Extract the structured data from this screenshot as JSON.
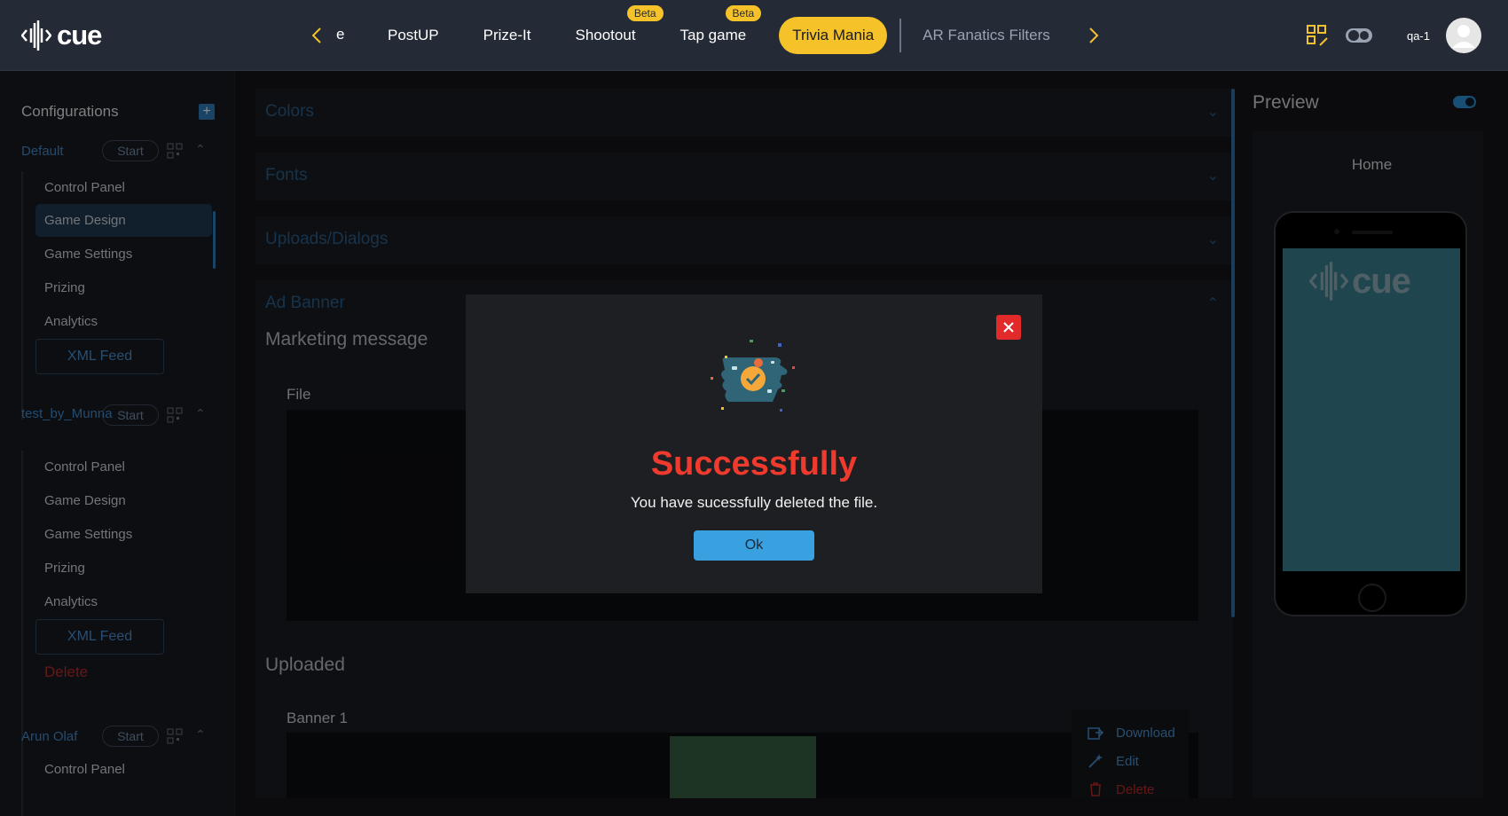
{
  "app": {
    "brand": "cue"
  },
  "nav": {
    "prev_partial": "e",
    "tabs": [
      {
        "label": "PostUP",
        "beta": ""
      },
      {
        "label": "Prize-It",
        "beta": ""
      },
      {
        "label": "Shootout",
        "beta": "Beta"
      },
      {
        "label": "Tap game",
        "beta": "Beta"
      }
    ],
    "active_tab": "Trivia Mania",
    "muted_tab": "AR Fanatics Filters"
  },
  "user": {
    "name": "qa-1"
  },
  "sidebar": {
    "title": "Configurations",
    "configs": [
      {
        "name": "Default",
        "start": "Start",
        "items": [
          "Control Panel",
          "Game Design",
          "Game Settings",
          "Prizing",
          "Analytics"
        ],
        "selected": "Game Design",
        "xml": "XML Feed"
      },
      {
        "name": "test_by_Munna",
        "start": "Start",
        "items": [
          "Control Panel",
          "Game Design",
          "Game Settings",
          "Prizing",
          "Analytics"
        ],
        "xml": "XML Feed",
        "delete": "Delete"
      },
      {
        "name": "Arun Olaf",
        "start": "Start",
        "items": [
          "Control Panel"
        ]
      }
    ]
  },
  "main": {
    "sections": [
      "Colors",
      "Fonts",
      "Uploads/Dialogs",
      "Ad Banner"
    ],
    "marketing_message": "Marketing message",
    "file_label": "File",
    "uploaded": "Uploaded",
    "banner_label": "Banner 1",
    "file_menu": {
      "download": "Download",
      "edit": "Edit",
      "delete": "Delete"
    }
  },
  "preview": {
    "title": "Preview",
    "screen": "Home",
    "brand": "cue"
  },
  "modal": {
    "title": "Successfully",
    "message": "You have sucessfully deleted the file.",
    "ok": "Ok"
  },
  "colors": {
    "accent": "#f6c22a",
    "primary": "#3aa1e0",
    "danger": "#e22a2a"
  }
}
